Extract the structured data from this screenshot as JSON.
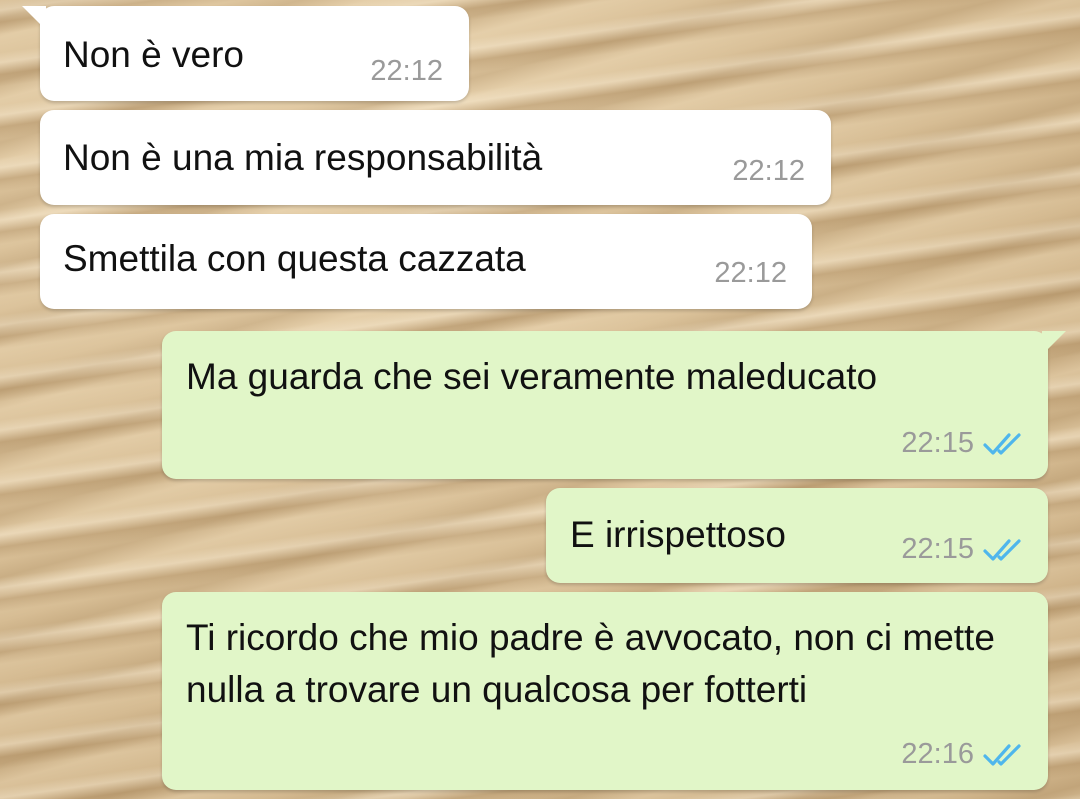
{
  "messages": [
    {
      "text": "Non è vero",
      "time": "22:12",
      "direction": "incoming"
    },
    {
      "text": "Non è una mia responsabilità",
      "time": "22:12",
      "direction": "incoming"
    },
    {
      "text": "Smettila con questa cazzata",
      "time": "22:12",
      "direction": "incoming"
    },
    {
      "text": "Ma guarda che sei veramente maleducato",
      "time": "22:15",
      "direction": "outgoing",
      "status": "read"
    },
    {
      "text": "E irrispettoso",
      "time": "22:15",
      "direction": "outgoing",
      "status": "read"
    },
    {
      "text": "Ti ricordo che mio padre è avvocato, non ci mette nulla a trovare un qualcosa per fotterti",
      "time": "22:16",
      "direction": "outgoing",
      "status": "read"
    }
  ],
  "icons": {
    "read_receipt": "double-check-icon"
  },
  "colors": {
    "incoming_bubble": "#ffffff",
    "outgoing_bubble": "#e1f6c8",
    "read_ticks": "#4fb6ec",
    "timestamp": "#9a9a9a",
    "text": "#111111"
  }
}
